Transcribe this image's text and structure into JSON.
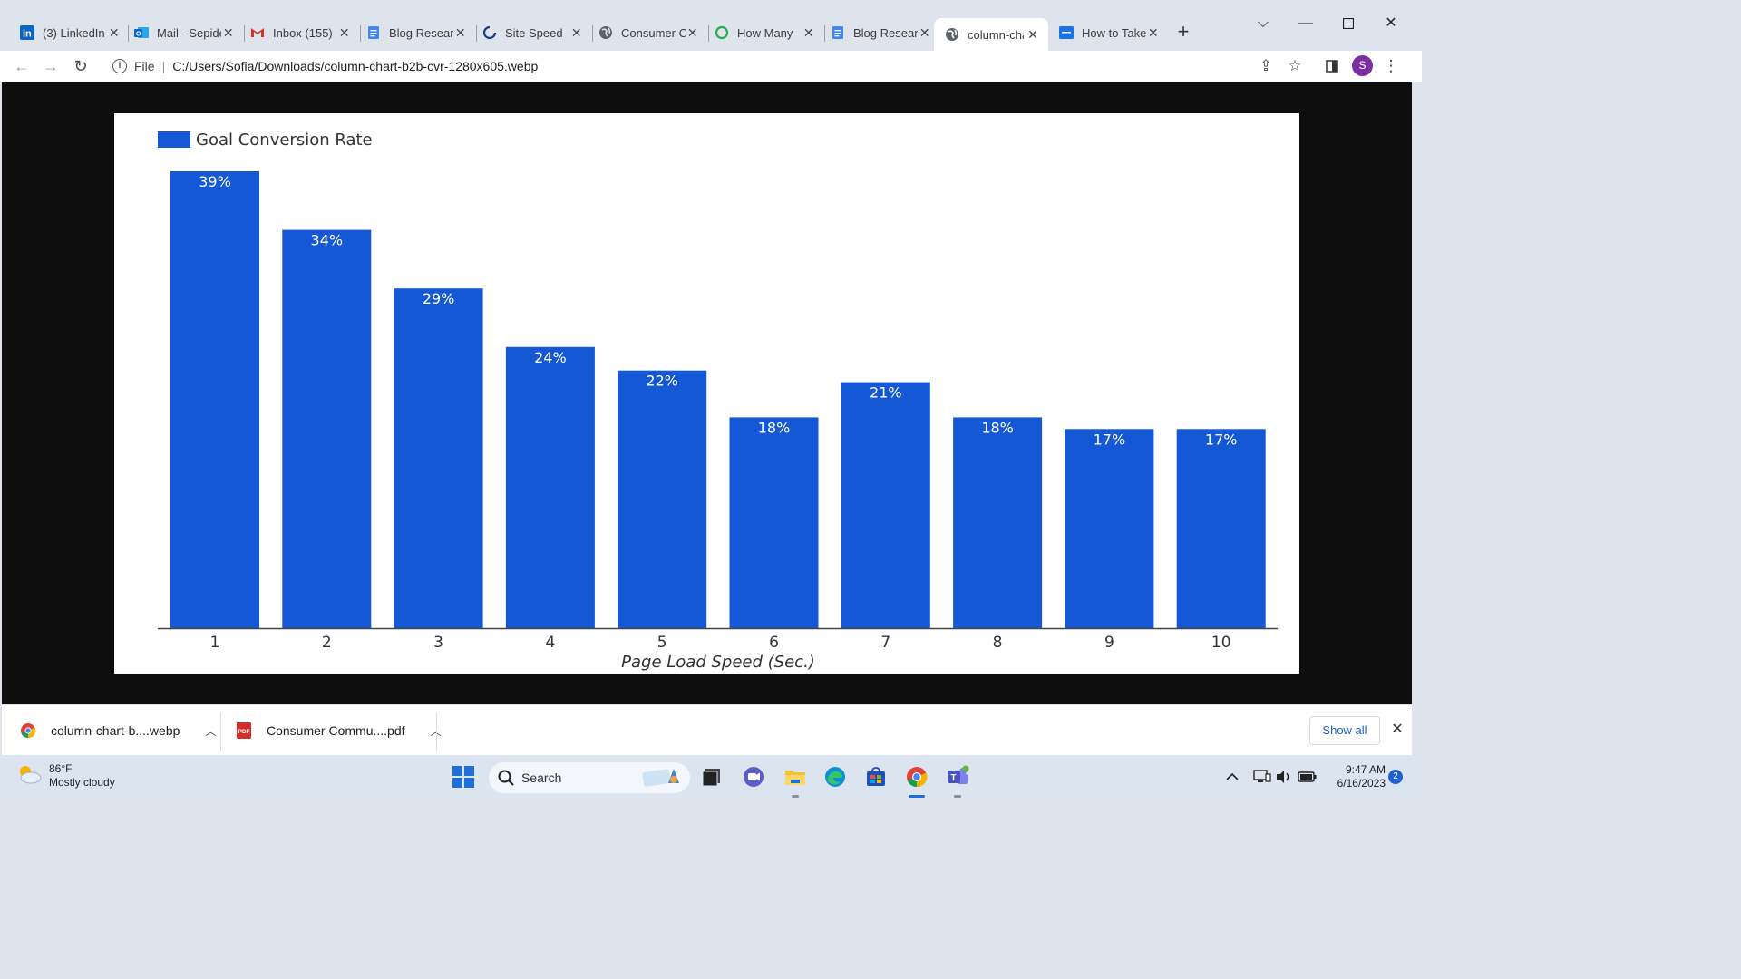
{
  "browser": {
    "tabs": [
      {
        "label": "(3) LinkedIn",
        "icon": "linkedin-icon"
      },
      {
        "label": "Mail - Sepideh",
        "icon": "outlook-icon"
      },
      {
        "label": "Inbox (155)",
        "icon": "gmail-icon"
      },
      {
        "label": "Blog Research",
        "icon": "docs-icon"
      },
      {
        "label": "Site Speed",
        "icon": "loader-icon"
      },
      {
        "label": "Consumer Communication",
        "icon": "globe-icon"
      },
      {
        "label": "How Many",
        "icon": "ring-icon"
      },
      {
        "label": "Blog Research",
        "icon": "docs-icon"
      },
      {
        "label": "column-chart",
        "icon": "globe-icon",
        "active": true
      },
      {
        "label": "How to Take",
        "icon": "page-icon"
      }
    ],
    "address": {
      "scheme": "File",
      "url": "C:/Users/Sofia/Downloads/column-chart-b2b-cvr-1280x605.webp"
    },
    "profile_initial": "S",
    "accent": "#1a5fd0"
  },
  "chart_data": {
    "type": "bar",
    "categories": [
      "1",
      "2",
      "3",
      "4",
      "5",
      "6",
      "7",
      "8",
      "9",
      "10"
    ],
    "series": [
      {
        "name": "Goal Conversion Rate",
        "values": [
          39,
          34,
          29,
          24,
          22,
          18,
          21,
          18,
          17,
          17
        ],
        "color": "#1558d6"
      }
    ],
    "data_labels": [
      "39%",
      "34%",
      "29%",
      "24%",
      "22%",
      "18%",
      "21%",
      "18%",
      "17%",
      "17%"
    ],
    "title": "",
    "xlabel": "Page Load Speed (Sec.)",
    "ylabel": "",
    "ylim": [
      0,
      39
    ],
    "grid": false,
    "legend_position": "top-left"
  },
  "downloads": {
    "items": [
      {
        "label": "column-chart-b....webp",
        "icon": "chrome-icon"
      },
      {
        "label": "Consumer Commu....pdf",
        "icon": "pdf-icon"
      }
    ],
    "show_all": "Show all"
  },
  "taskbar": {
    "weather_temp": "86°F",
    "weather_desc": "Mostly cloudy",
    "search_label": "Search",
    "time": "9:47 AM",
    "date": "6/16/2023",
    "notification_count": "2"
  }
}
